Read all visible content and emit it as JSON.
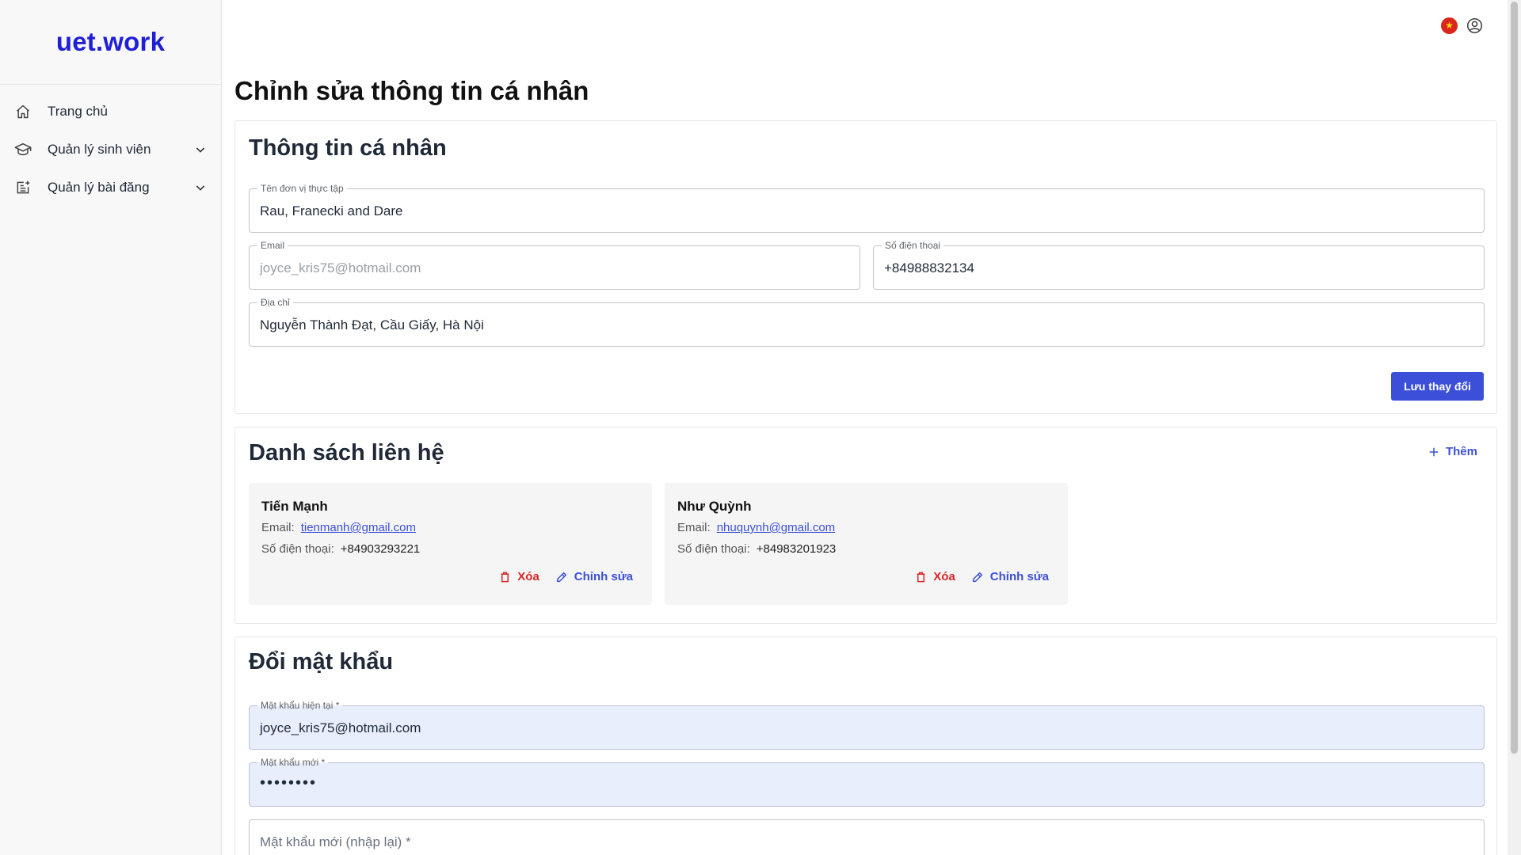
{
  "app": {
    "logo": "uet.work"
  },
  "sidebar": {
    "items": [
      {
        "label": "Trang chủ",
        "icon": "home-icon"
      },
      {
        "label": "Quản lý sinh viên",
        "icon": "graduation-cap-icon"
      },
      {
        "label": "Quản lý bài đăng",
        "icon": "post-add-icon"
      }
    ]
  },
  "header": {
    "language_flag": "vietnam-flag-icon",
    "user_icon": "user-circle-icon"
  },
  "page": {
    "title": "Chỉnh sửa thông tin cá nhân"
  },
  "profile": {
    "title": "Thông tin cá nhân",
    "company_label": "Tên đơn vị thực tập",
    "company_value": "Rau, Franecki and Dare",
    "email_label": "Email",
    "email_value": "joyce_kris75@hotmail.com",
    "phone_label": "Số điện thoại",
    "phone_value": "+84988832134",
    "address_label": "Địa chỉ",
    "address_value": "Nguyễn Thành Đạt, Cầu Giấy, Hà Nội",
    "save_label": "Lưu thay đổi"
  },
  "contacts": {
    "title": "Danh sách liên hệ",
    "add_label": "Thêm",
    "email_prefix": "Email:",
    "phone_prefix": "Số điện thoại:",
    "delete_label": "Xóa",
    "edit_label": "Chỉnh sửa",
    "items": [
      {
        "name": "Tiến Mạnh",
        "email": "tienmanh@gmail.com",
        "phone": "+84903293221"
      },
      {
        "name": "Như Quỳnh",
        "email": "nhuquynh@gmail.com",
        "phone": "+84983201923"
      }
    ]
  },
  "password": {
    "title": "Đổi mật khẩu",
    "current_label": "Mật khẩu hiện tại *",
    "current_value": "joyce_kris75@hotmail.com",
    "new_label": "Mật khẩu mới *",
    "new_value": "••••••••",
    "confirm_placeholder": "Mật khẩu mới (nhập lại) *"
  },
  "colors": {
    "brand": "#1f1fd8",
    "primary": "#3b4fd8",
    "danger": "#dc2626"
  }
}
